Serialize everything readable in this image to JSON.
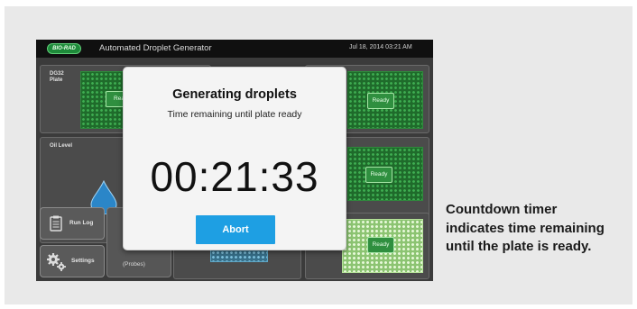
{
  "device": {
    "logo_text": "BIO-RAD",
    "app_title": "Automated Droplet Generator",
    "datetime": "Jul 18, 2014 03:21 AM",
    "plate_label_line1": "DG32",
    "plate_label_line2": "Plate",
    "oil_level_label": "Oil Level",
    "ready_label": "Ready",
    "ready_partial": "Rea",
    "run_log_label": "Run Log",
    "settings_label": "Settings",
    "probes_label": "(Probes)"
  },
  "modal": {
    "title": "Generating droplets",
    "subtitle": "Time remaining until plate ready",
    "timer": "00:21:33",
    "abort_label": "Abort"
  },
  "caption": "Countdown timer indicates time remaining until the plate is ready.",
  "colors": {
    "accent_blue": "#1e9fe3",
    "ready_green": "#2f8f3f",
    "oil_blue": "#2b86c8"
  },
  "icons": [
    "clipboard-icon",
    "gears-icon",
    "oil-drop-icon"
  ]
}
